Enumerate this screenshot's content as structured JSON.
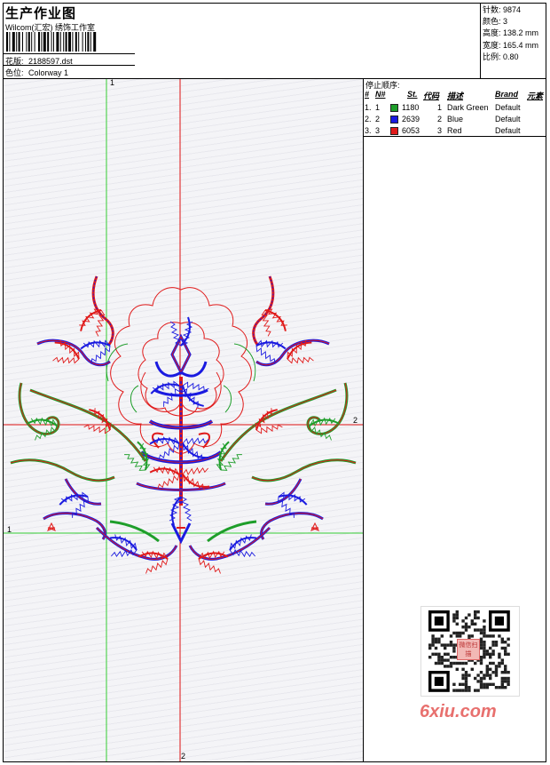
{
  "header": {
    "title": "生产作业图",
    "subtitle": "Wilcom(汇宏) 绣饰工作室",
    "design_label": "花版:",
    "design_value": "2188597.dst",
    "colorway_label": "色位:",
    "colorway_value": "Colorway 1"
  },
  "stats": [
    {
      "label": "针数:",
      "value": "9874"
    },
    {
      "label": "颜色:",
      "value": "3"
    },
    {
      "label": "高度:",
      "value": "138.2 mm"
    },
    {
      "label": "宽度:",
      "value": "165.4 mm"
    },
    {
      "label": "比例:",
      "value": "0.80"
    }
  ],
  "stop_sequence": {
    "title": "停止顺序:",
    "columns": {
      "hash": "#",
      "n": "N#",
      "st": "St.",
      "code": "代码",
      "desc": "描述",
      "brand": "Brand",
      "element": "元素"
    },
    "rows": [
      {
        "hash": "1.",
        "n": "1",
        "color": "#1e9e2a",
        "st": "1180",
        "code": "1",
        "desc": "Dark Green",
        "brand": "Default"
      },
      {
        "hash": "2.",
        "n": "2",
        "color": "#1a1ae0",
        "st": "2639",
        "code": "2",
        "desc": "Blue",
        "brand": "Default"
      },
      {
        "hash": "3.",
        "n": "3",
        "color": "#e01a1a",
        "st": "6053",
        "code": "3",
        "desc": "Red",
        "brand": "Default"
      }
    ]
  },
  "axis_markers": {
    "v1": "1",
    "h2": "2",
    "h1": "1",
    "v2": "2"
  },
  "colors": {
    "guide_green": "#33cc33",
    "guide_red": "#dd1111",
    "stitch_red": "#e01a1a",
    "stitch_blue": "#1a1ae0",
    "stitch_green": "#1e9e2a"
  },
  "watermark": "6xiu.com",
  "qr_badge": "微信扫描"
}
